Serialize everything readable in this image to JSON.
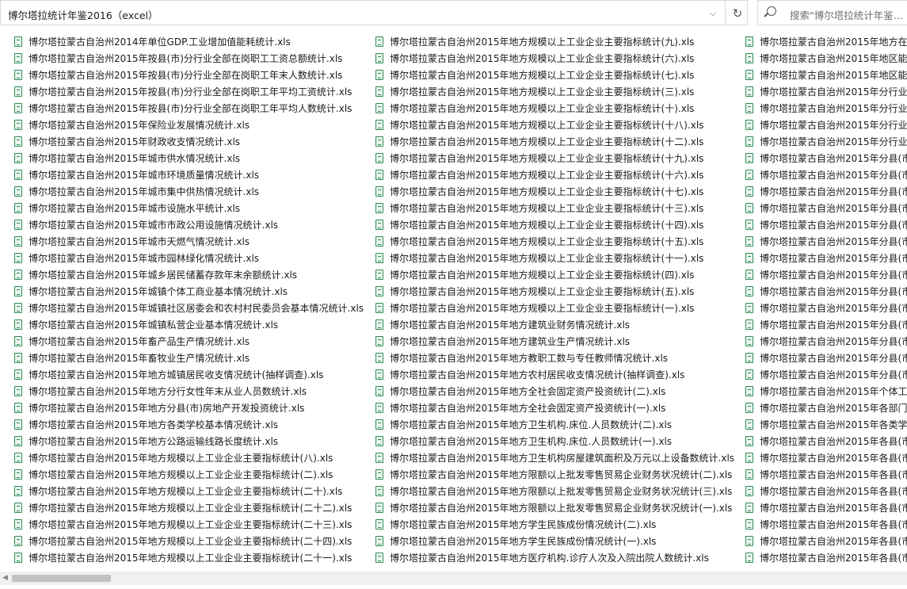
{
  "address": {
    "path": "博尔塔拉统计年鉴2016（excel）",
    "dropdown_glyph": "⌵",
    "refresh_glyph": "↻"
  },
  "search": {
    "placeholder": "搜索\"博尔塔拉统计年鉴..."
  },
  "files": {
    "col1": [
      "博尔塔拉蒙古自治州2014年单位GDP.工业增加值能耗统计.xls",
      "博尔塔拉蒙古自治州2015年按县(市)分行业全部在岗职工工资总额统计.xls",
      "博尔塔拉蒙古自治州2015年按县(市)分行业全部在岗职工年末人数统计.xls",
      "博尔塔拉蒙古自治州2015年按县(市)分行业全部在岗职工年平均工资统计.xls",
      "博尔塔拉蒙古自治州2015年按县(市)分行业全部在岗职工年平均人数统计.xls",
      "博尔塔拉蒙古自治州2015年保险业发展情况统计.xls",
      "博尔塔拉蒙古自治州2015年财政收支情况统计.xls",
      "博尔塔拉蒙古自治州2015年城市供水情况统计.xls",
      "博尔塔拉蒙古自治州2015年城市环境质量情况统计.xls",
      "博尔塔拉蒙古自治州2015年城市集中供热情况统计.xls",
      "博尔塔拉蒙古自治州2015年城市设施水平统计.xls",
      "博尔塔拉蒙古自治州2015年城市市政公用设施情况统计.xls",
      "博尔塔拉蒙古自治州2015年城市天燃气情况统计.xls",
      "博尔塔拉蒙古自治州2015年城市园林绿化情况统计.xls",
      "博尔塔拉蒙古自治州2015年城乡居民储蓄存款年末余额统计.xls",
      "博尔塔拉蒙古自治州2015年城镇个体工商业基本情况统计.xls",
      "博尔塔拉蒙古自治州2015年城镇社区居委会和农村村民委员会基本情况统计.xls",
      "博尔塔拉蒙古自治州2015年城镇私营企业基本情况统计.xls",
      "博尔塔拉蒙古自治州2015年畜产品生产情况统计.xls",
      "博尔塔拉蒙古自治州2015年畜牧业生产情况统计.xls",
      "博尔塔拉蒙古自治州2015年地方城镇居民收支情况统计(抽样调查).xls",
      "博尔塔拉蒙古自治州2015年地方分行女性年末从业人员数统计.xls",
      "博尔塔拉蒙古自治州2015年地方分县(市)房地产开发投资统计.xls",
      "博尔塔拉蒙古自治州2015年地方各类学校基本情况统计.xls",
      "博尔塔拉蒙古自治州2015年地方公路运输线路长度统计.xls",
      "博尔塔拉蒙古自治州2015年地方规模以上工业企业主要指标统计(八).xls",
      "博尔塔拉蒙古自治州2015年地方规模以上工业企业主要指标统计(二).xls",
      "博尔塔拉蒙古自治州2015年地方规模以上工业企业主要指标统计(二十).xls",
      "博尔塔拉蒙古自治州2015年地方规模以上工业企业主要指标统计(二十二).xls",
      "博尔塔拉蒙古自治州2015年地方规模以上工业企业主要指标统计(二十三).xls",
      "博尔塔拉蒙古自治州2015年地方规模以上工业企业主要指标统计(二十四).xls",
      "博尔塔拉蒙古自治州2015年地方规模以上工业企业主要指标统计(二十一).xls"
    ],
    "col2": [
      "博尔塔拉蒙古自治州2015年地方规模以上工业企业主要指标统计(九).xls",
      "博尔塔拉蒙古自治州2015年地方规模以上工业企业主要指标统计(六).xls",
      "博尔塔拉蒙古自治州2015年地方规模以上工业企业主要指标统计(七).xls",
      "博尔塔拉蒙古自治州2015年地方规模以上工业企业主要指标统计(三).xls",
      "博尔塔拉蒙古自治州2015年地方规模以上工业企业主要指标统计(十).xls",
      "博尔塔拉蒙古自治州2015年地方规模以上工业企业主要指标统计(十八).xls",
      "博尔塔拉蒙古自治州2015年地方规模以上工业企业主要指标统计(十二).xls",
      "博尔塔拉蒙古自治州2015年地方规模以上工业企业主要指标统计(十九).xls",
      "博尔塔拉蒙古自治州2015年地方规模以上工业企业主要指标统计(十六).xls",
      "博尔塔拉蒙古自治州2015年地方规模以上工业企业主要指标统计(十七).xls",
      "博尔塔拉蒙古自治州2015年地方规模以上工业企业主要指标统计(十三).xls",
      "博尔塔拉蒙古自治州2015年地方规模以上工业企业主要指标统计(十四).xls",
      "博尔塔拉蒙古自治州2015年地方规模以上工业企业主要指标统计(十五).xls",
      "博尔塔拉蒙古自治州2015年地方规模以上工业企业主要指标统计(十一).xls",
      "博尔塔拉蒙古自治州2015年地方规模以上工业企业主要指标统计(四).xls",
      "博尔塔拉蒙古自治州2015年地方规模以上工业企业主要指标统计(五).xls",
      "博尔塔拉蒙古自治州2015年地方规模以上工业企业主要指标统计(一).xls",
      "博尔塔拉蒙古自治州2015年地方建筑业财务情况统计.xls",
      "博尔塔拉蒙古自治州2015年地方建筑业生产情况统计.xls",
      "博尔塔拉蒙古自治州2015年地方教职工数与专任教师情况统计.xls",
      "博尔塔拉蒙古自治州2015年地方农村居民收支情况统计(抽样调查).xls",
      "博尔塔拉蒙古自治州2015年地方全社会固定资产投资统计(二).xls",
      "博尔塔拉蒙古自治州2015年地方全社会固定资产投资统计(一).xls",
      "博尔塔拉蒙古自治州2015年地方卫生机构.床位.人员数统计(二).xls",
      "博尔塔拉蒙古自治州2015年地方卫生机构.床位.人员数统计(一).xls",
      "博尔塔拉蒙古自治州2015年地方卫生机构房屋建筑面积及万元以上设备数统计.xls",
      "博尔塔拉蒙古自治州2015年地方限额以上批发零售贸易企业财务状况统计(二).xls",
      "博尔塔拉蒙古自治州2015年地方限额以上批发零售贸易企业财务状况统计(三).xls",
      "博尔塔拉蒙古自治州2015年地方限额以上批发零售贸易企业财务状况统计(一).xls",
      "博尔塔拉蒙古自治州2015年地方学生民族成份情况统计(二).xls",
      "博尔塔拉蒙古自治州2015年地方学生民族成份情况统计(一).xls",
      "博尔塔拉蒙古自治州2015年地方医疗机构.诊疗人次及入院出院人数统计.xls"
    ],
    "col3": [
      "博尔塔拉蒙古自治州2015年地方在岗",
      "博尔塔拉蒙古自治州2015年地区能源",
      "博尔塔拉蒙古自治州2015年地区能源",
      "博尔塔拉蒙古自治州2015年分行业全",
      "博尔塔拉蒙古自治州2015年分行业全",
      "博尔塔拉蒙古自治州2015年分行业全",
      "博尔塔拉蒙古自治州2015年分行业全",
      "博尔塔拉蒙古自治州2015年分县(市)",
      "博尔塔拉蒙古自治州2015年分县(市)",
      "博尔塔拉蒙古自治州2015年分县(市)",
      "博尔塔拉蒙古自治州2015年分县(市)",
      "博尔塔拉蒙古自治州2015年分县(市)",
      "博尔塔拉蒙古自治州2015年分县(市)",
      "博尔塔拉蒙古自治州2015年分县(市)",
      "博尔塔拉蒙古自治州2015年分县(市)",
      "博尔塔拉蒙古自治州2015年分县(市)",
      "博尔塔拉蒙古自治州2015年分县(市)",
      "博尔塔拉蒙古自治州2015年分县(市)",
      "博尔塔拉蒙古自治州2015年分县(市)",
      "博尔塔拉蒙古自治州2015年分县(市)",
      "博尔塔拉蒙古自治州2015年分县(市)",
      "博尔塔拉蒙古自治州2015年个体工商",
      "博尔塔拉蒙古自治州2015年各部门预",
      "博尔塔拉蒙古自治州2015年各类学校",
      "博尔塔拉蒙古自治州2015年各县(市)",
      "博尔塔拉蒙古自治州2015年各县(市)",
      "博尔塔拉蒙古自治州2015年各县(市)",
      "博尔塔拉蒙古自治州2015年各县(市)",
      "博尔塔拉蒙古自治州2015年各县(市)",
      "博尔塔拉蒙古自治州2015年各县(市)",
      "博尔塔拉蒙古自治州2015年各县(市)",
      "博尔塔拉蒙古自治州2015年各县(市)"
    ]
  }
}
